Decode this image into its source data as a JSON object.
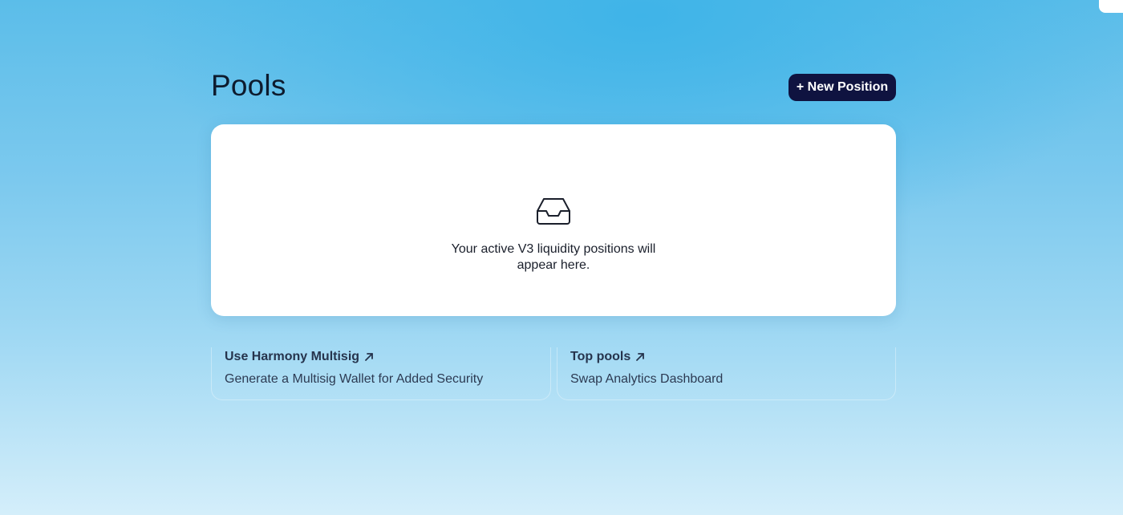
{
  "header": {
    "title": "Pools",
    "new_position_label": "+ New Position"
  },
  "empty_state": {
    "icon": "inbox-icon",
    "line1": "Your active V3 liquidity positions will",
    "line2": "appear here."
  },
  "links": [
    {
      "title": "Use Harmony Multisig",
      "subtitle": "Generate a Multisig Wallet for Added Security",
      "icon": "arrow-up-right-icon"
    },
    {
      "title": "Top pools",
      "subtitle": "Swap Analytics Dashboard",
      "icon": "arrow-up-right-icon"
    }
  ],
  "colors": {
    "button_bg": "#0f1340",
    "title_text": "#0d1b2e",
    "card_bg": "#ffffff"
  }
}
